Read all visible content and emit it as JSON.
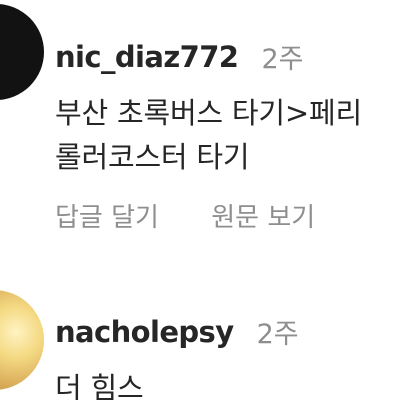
{
  "comments": [
    {
      "username": "nic_diaz772",
      "time": "2주",
      "text_line1": "부산 초록버스 타기>페리",
      "text_line2": "롤러코스터 타기",
      "reply_label": "답글 달기",
      "original_label": "원문 보기"
    },
    {
      "username": "nacholepsy",
      "time": "2주",
      "text_line1": "더 힘스"
    }
  ],
  "colors": {
    "primary_text": "#262626",
    "secondary_text": "#8e8e8e"
  }
}
